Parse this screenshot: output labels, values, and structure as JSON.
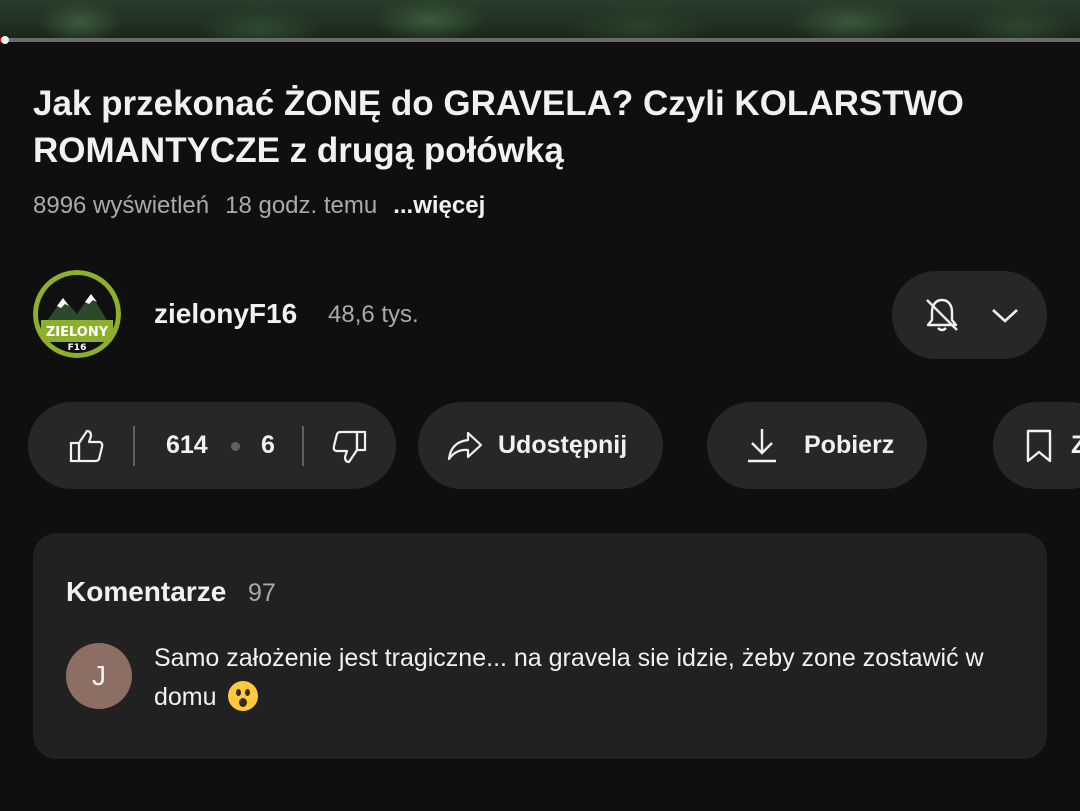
{
  "video": {
    "title": "Jak przekonać ŻONĘ do GRAVELA?  Czyli KOLARSTWO ROMANTYCZE z drugą połówką",
    "views": "8996 wyświetleń",
    "age": "18 godz. temu",
    "more_label": "...więcej",
    "progress_fraction": 0.005
  },
  "channel": {
    "name": "zielonyF16",
    "subscribers": "48,6 tys.",
    "logo_text": "ZIELONY",
    "logo_sub": "F16",
    "subscribe_icons": [
      "bell-off-icon",
      "chevron-down-icon"
    ]
  },
  "actions": {
    "likes": "614",
    "dislikes": "6",
    "share_label": "Udostępnij",
    "download_label": "Pobierz",
    "save_label": "Z",
    "icons": [
      "thumbs-up-icon",
      "thumbs-down-icon",
      "share-icon",
      "download-icon",
      "bookmark-icon"
    ]
  },
  "comments": {
    "heading": "Komentarze",
    "count": "97",
    "top_comment": {
      "avatar_letter": "J",
      "text": "Samo założenie jest tragiczne... na gravela sie idzie, żeby zone zostawić w domu",
      "emoji": "face-with-open-mouth"
    }
  },
  "colors": {
    "background": "#0f0f0f",
    "pill": "#272727",
    "card": "#212121",
    "secondary_text": "#aaaaaa",
    "avatar_bg": "#8d6e63",
    "logo_green": "#8fae2a"
  }
}
